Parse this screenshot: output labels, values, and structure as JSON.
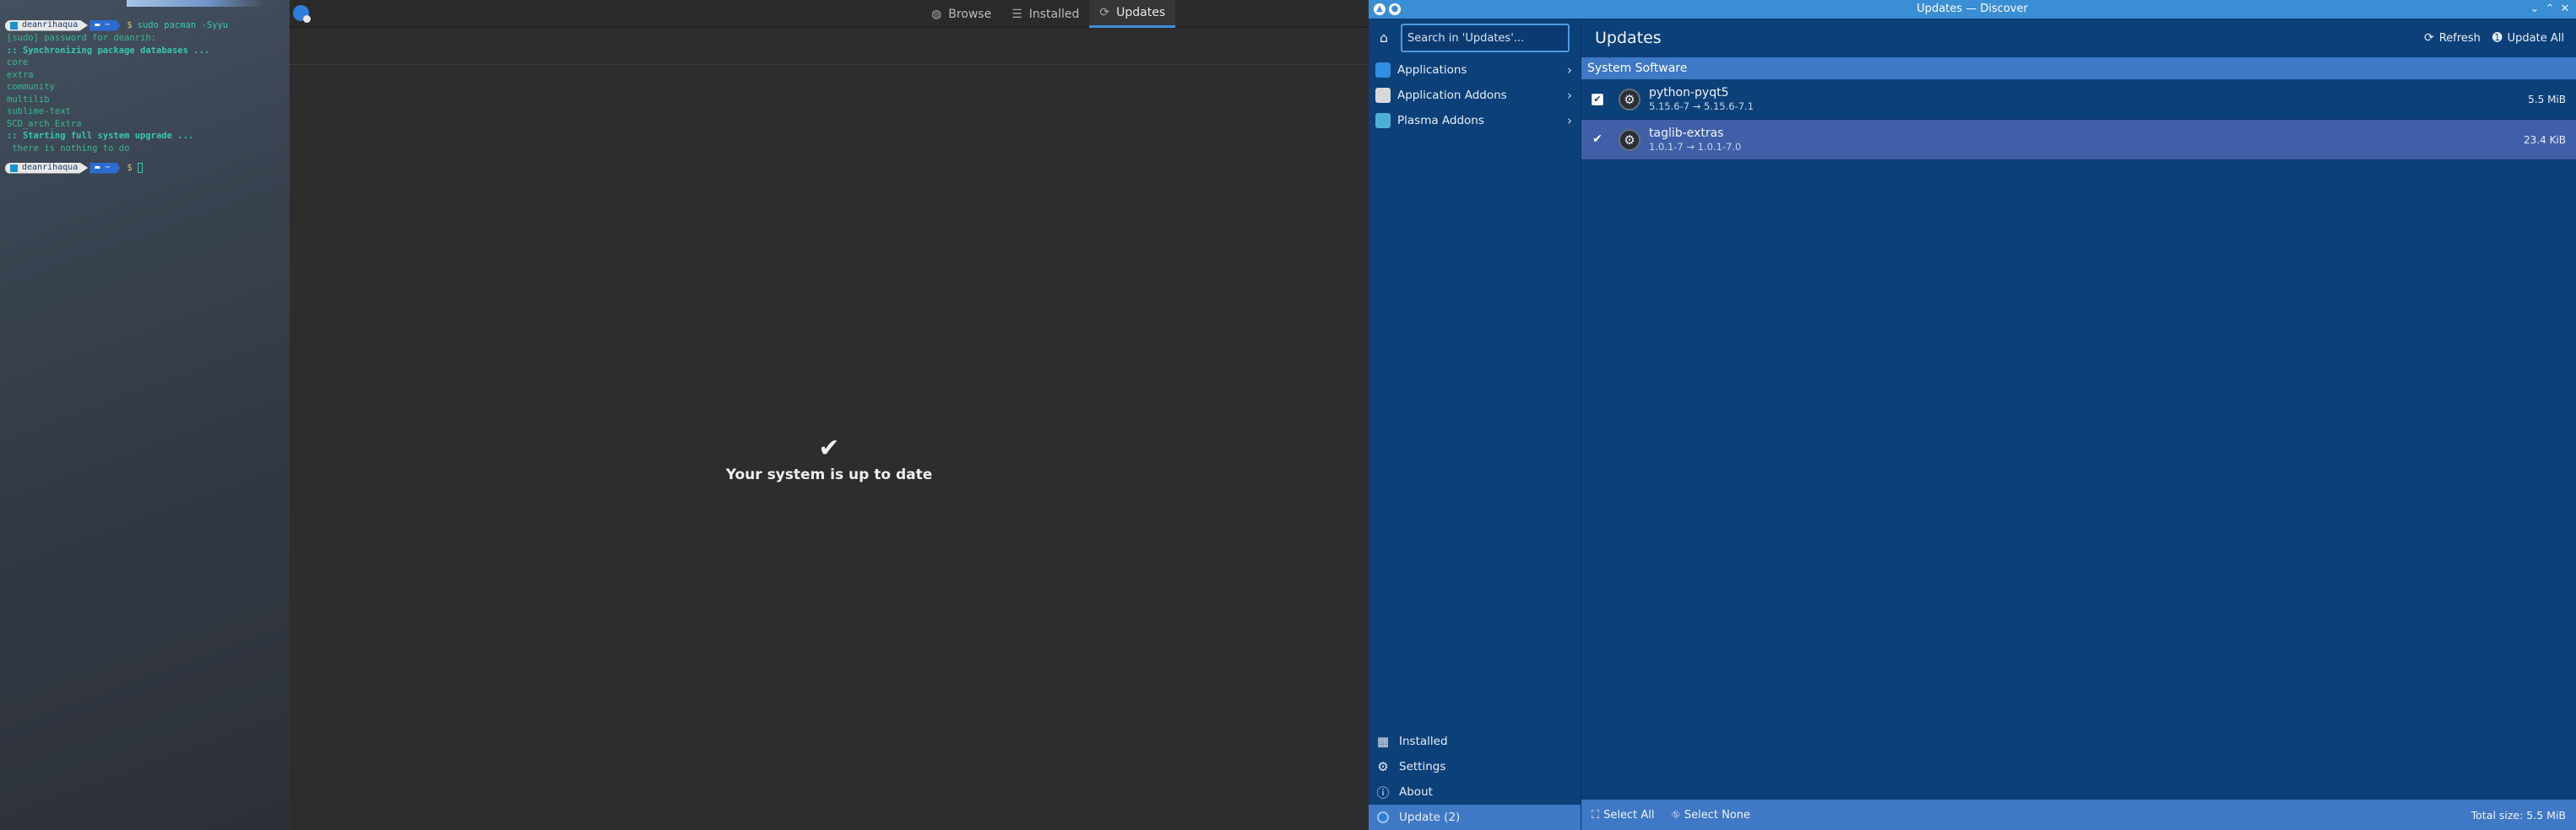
{
  "terminal": {
    "prompt": {
      "user": "deanrihaqua",
      "dir": "~",
      "dollar": "$"
    },
    "command": "sudo pacman -Syyu",
    "lines": [
      {
        "text": "[sudo] password for deanrih:",
        "style": "green"
      },
      {
        "text": ":: Synchronizing package databases ...",
        "style": "bold"
      },
      {
        "text": "core",
        "style": "green"
      },
      {
        "text": "extra",
        "style": "green"
      },
      {
        "text": "community",
        "style": "green"
      },
      {
        "text": "multilib",
        "style": "green"
      },
      {
        "text": "sublime-text",
        "style": "green"
      },
      {
        "text": "SCD_arch_Extra",
        "style": "green"
      },
      {
        "text": ":: Starting full system upgrade ...",
        "style": "bold"
      },
      {
        "text": " there is nothing to do",
        "style": "green"
      }
    ]
  },
  "mid_window": {
    "tabs": [
      {
        "label": "Browse",
        "icon": "globe-icon"
      },
      {
        "label": "Installed",
        "icon": "list-icon"
      },
      {
        "label": "Updates",
        "icon": "refresh-icon",
        "active": true
      }
    ],
    "status": {
      "icon": "checkmark-icon",
      "text": "Your system is up to date"
    }
  },
  "discover": {
    "title": "Updates — Discover",
    "search_placeholder": "Search in 'Updates'...",
    "categories": [
      {
        "label": "Applications",
        "icon": "applications-icon",
        "color": "#2f8de4"
      },
      {
        "label": "Application Addons",
        "icon": "addons-icon",
        "color": "#d8d8d8"
      },
      {
        "label": "Plasma Addons",
        "icon": "plasma-icon",
        "color": "#4fb0d6"
      }
    ],
    "bottom_nav": [
      {
        "label": "Installed",
        "icon": "grid-icon"
      },
      {
        "label": "Settings",
        "icon": "settings-icon"
      },
      {
        "label": "About",
        "icon": "info-icon"
      },
      {
        "label": "Update (2)",
        "icon": "update-icon",
        "active": true
      }
    ],
    "header": {
      "title": "Updates",
      "refresh_label": "Refresh",
      "update_all_label": "Update All"
    },
    "section": "System Software",
    "updates": [
      {
        "name": "python-pyqt5",
        "version": "5.15.6-7 → 5.15.6-7.1",
        "size": "5.5 MiB",
        "checked": true,
        "selected": false
      },
      {
        "name": "taglib-extras",
        "version": "1.0.1-7 → 1.0.1-7.0",
        "size": "23.4 KiB",
        "checked": true,
        "selected": true
      }
    ],
    "footer": {
      "select_all": "Select All",
      "select_none": "Select None",
      "total": "Total size: 5.5 MiB"
    },
    "colors": {
      "background": "#0c4078",
      "accent": "#3f78c5",
      "titlebar": "#3a8ed4"
    }
  }
}
